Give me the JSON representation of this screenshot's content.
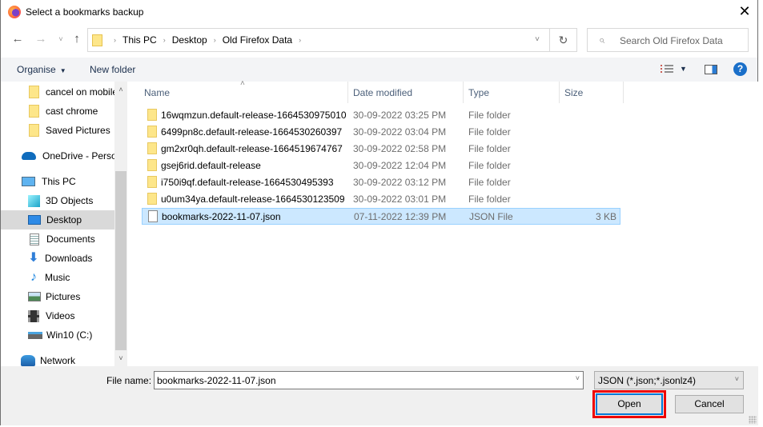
{
  "window": {
    "title": "Select a bookmarks backup",
    "close_label": "✕"
  },
  "nav": {
    "back_icon": "←",
    "forward_icon": "→",
    "recent_icon": "˅",
    "up_icon": "↑",
    "breadcrumbs": [
      "This PC",
      "Desktop",
      "Old Firefox Data"
    ],
    "separator": "›",
    "dropdown_icon": "˅",
    "refresh_icon": "↻",
    "search_placeholder": "Search Old Firefox Data",
    "search_icon": "⌕"
  },
  "toolbar": {
    "organise_label": "Organise",
    "organise_caret": "▼",
    "new_folder_label": "New folder",
    "view_caret": "▼",
    "help_label": "?"
  },
  "sidebar": {
    "items": [
      {
        "label": "cancel on mobile",
        "icon": "folder-icon"
      },
      {
        "label": "cast chrome",
        "icon": "folder-icon"
      },
      {
        "label": "Saved Pictures",
        "icon": "folder-icon"
      },
      {
        "label": "OneDrive - Personal",
        "icon": "onedrive-icon"
      },
      {
        "label": "This PC",
        "icon": "this-pc-icon"
      },
      {
        "label": "3D Objects",
        "icon": "3d-objects-icon"
      },
      {
        "label": "Desktop",
        "icon": "desktop-icon",
        "selected": true
      },
      {
        "label": "Documents",
        "icon": "documents-icon"
      },
      {
        "label": "Downloads",
        "icon": "downloads-icon"
      },
      {
        "label": "Music",
        "icon": "music-icon"
      },
      {
        "label": "Pictures",
        "icon": "pictures-icon"
      },
      {
        "label": "Videos",
        "icon": "videos-icon"
      },
      {
        "label": "Win10 (C:)",
        "icon": "drive-icon"
      },
      {
        "label": "Network",
        "icon": "network-icon"
      }
    ],
    "scroll_up": "˄",
    "scroll_down": "˅"
  },
  "filelist": {
    "columns": [
      "Name",
      "Date modified",
      "Type",
      "Size"
    ],
    "sort_indicator": "˄",
    "rows": [
      {
        "name": "16wqmzun.default-release-1664530975010",
        "date": "30-09-2022 03:25 PM",
        "type": "File folder",
        "size": ""
      },
      {
        "name": "6499pn8c.default-release-1664530260397",
        "date": "30-09-2022 03:04 PM",
        "type": "File folder",
        "size": ""
      },
      {
        "name": "gm2xr0qh.default-release-1664519674767",
        "date": "30-09-2022 02:58 PM",
        "type": "File folder",
        "size": ""
      },
      {
        "name": "gsej6rid.default-release",
        "date": "30-09-2022 12:04 PM",
        "type": "File folder",
        "size": ""
      },
      {
        "name": "i750i9qf.default-release-1664530495393",
        "date": "30-09-2022 03:12 PM",
        "type": "File folder",
        "size": ""
      },
      {
        "name": "u0um34ya.default-release-1664530123509",
        "date": "30-09-2022 03:01 PM",
        "type": "File folder",
        "size": ""
      },
      {
        "name": "bookmarks-2022-11-07.json",
        "date": "07-11-2022 12:39 PM",
        "type": "JSON File",
        "size": "3 KB",
        "selected": true
      }
    ]
  },
  "bottom": {
    "file_name_label": "File name:",
    "file_name_value": "bookmarks-2022-11-07.json",
    "file_type_value": "JSON (*.json;*.jsonlz4)",
    "dropdown_icon": "˅",
    "open_label": "Open",
    "cancel_label": "Cancel"
  },
  "colors": {
    "selection_bg": "#cce8ff",
    "selection_border": "#99d1ff",
    "highlight": "#ee0000",
    "focus": "#0078d7"
  }
}
